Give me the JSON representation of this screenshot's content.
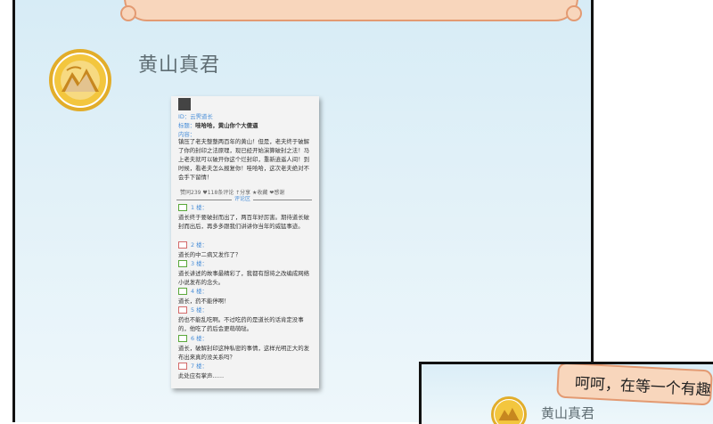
{
  "left_panel": {
    "speaker_name": "黄山真君"
  },
  "post_card": {
    "id_line": "ID：云霁道长",
    "title_label": "标题：",
    "title_text": "哇哈哈，黄山你个大傻逼",
    "content_label": "内容：",
    "content_text": "镇压了老夫整整两百年的黄山！但是，老夫终于破解了你的封印之法原理，现已经开始演算破封之法！马上老夫就可以破开你这个烂封印，重新逍遥人间！到时候，看老夫怎么报复你！哇哈哈，这次老夫绝对不会手下留情！",
    "actions": "赞同239  ♥118条评论  ↑分享  ★收藏  ❤感谢",
    "divider_label": "评论区",
    "comments": [
      {
        "floor": "1 楼：",
        "text": "道长终于要破封而出了，两百年好厉害。期待道长破封而出后，再多多跟我们讲讲你当年的威猛事迹。",
        "icon_color": "#5aa83a"
      },
      {
        "floor": "2 楼：",
        "text": "道长的中二病又发作了？",
        "icon_color": "#d46a6a"
      },
      {
        "floor": "3 楼：",
        "text": "道长讲述的故事最精彩了，我都有想将之改编成网络小说发布的念头。",
        "icon_color": "#5aa83a"
      },
      {
        "floor": "4 楼：",
        "text": "道长，药不能停啊！",
        "icon_color": "#5aa83a"
      },
      {
        "floor": "5 楼：",
        "text": "药也不能乱吃啊。不过吃药的是道长的话肯定没事的，他吃了药后会更萌萌哒。",
        "icon_color": "#d46a6a"
      },
      {
        "floor": "6 楼：",
        "text": "道长，破解封印这种私密的事情，这样光明正大的发布出来真的没关系吗？",
        "icon_color": "#5aa83a"
      },
      {
        "floor": "7 楼：",
        "text": "此处应有掌声……",
        "icon_color": "#d46a6a"
      }
    ]
  },
  "right_panel": {
    "speech": "呵呵，在等一个有趣",
    "speaker_name": "黄山真君"
  },
  "colors": {
    "bubble_fill": "#f8d6bc",
    "bubble_border": "#e39a72",
    "avatar_ring": "#e2ad2a",
    "link_blue": "#4a8fd8"
  }
}
